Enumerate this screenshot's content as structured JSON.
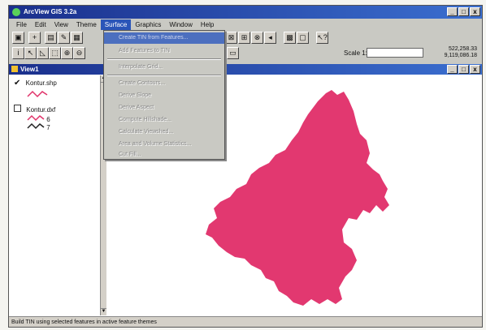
{
  "app": {
    "title": "ArcView GIS 3.2a"
  },
  "window_buttons": {
    "minimize": "_",
    "maximize": "□",
    "close": "x"
  },
  "menus": [
    "File",
    "Edit",
    "View",
    "Theme",
    "Surface",
    "Graphics",
    "Window",
    "Help"
  ],
  "active_menu": "Surface",
  "surface_menu_items": [
    {
      "label": "Create TIN from Features...",
      "enabled": true,
      "highlighted": true
    },
    {
      "label": "Add Features to TIN",
      "enabled": false
    },
    {
      "label": "Interpolate Grid...",
      "enabled": false
    },
    {
      "label": "Create Contours...",
      "enabled": false
    },
    {
      "label": "Derive Slope",
      "enabled": false
    },
    {
      "label": "Derive Aspect",
      "enabled": false
    },
    {
      "label": "Compute Hillshade...",
      "enabled": false
    },
    {
      "label": "Calculate Viewshed...",
      "enabled": false
    },
    {
      "label": "Area and Volume Statistics...",
      "enabled": false
    },
    {
      "label": "Cut Fill...",
      "enabled": false
    }
  ],
  "toolbar": {
    "scale_label": "Scale 1:",
    "scale_value": "",
    "coord_x": "522,258.33",
    "coord_y": "9,119,086.18"
  },
  "view": {
    "title": "View1",
    "layers": [
      {
        "name": "Kontur.shp",
        "visible": true,
        "symbol_color": "#e0336a"
      },
      {
        "name": "Kontur.dxf",
        "visible": false,
        "classes": [
          "6",
          "7"
        ]
      }
    ]
  },
  "map": {
    "fill_color": "#e23870"
  },
  "status": {
    "text": "Build TIN using selected features in active feature themes"
  }
}
